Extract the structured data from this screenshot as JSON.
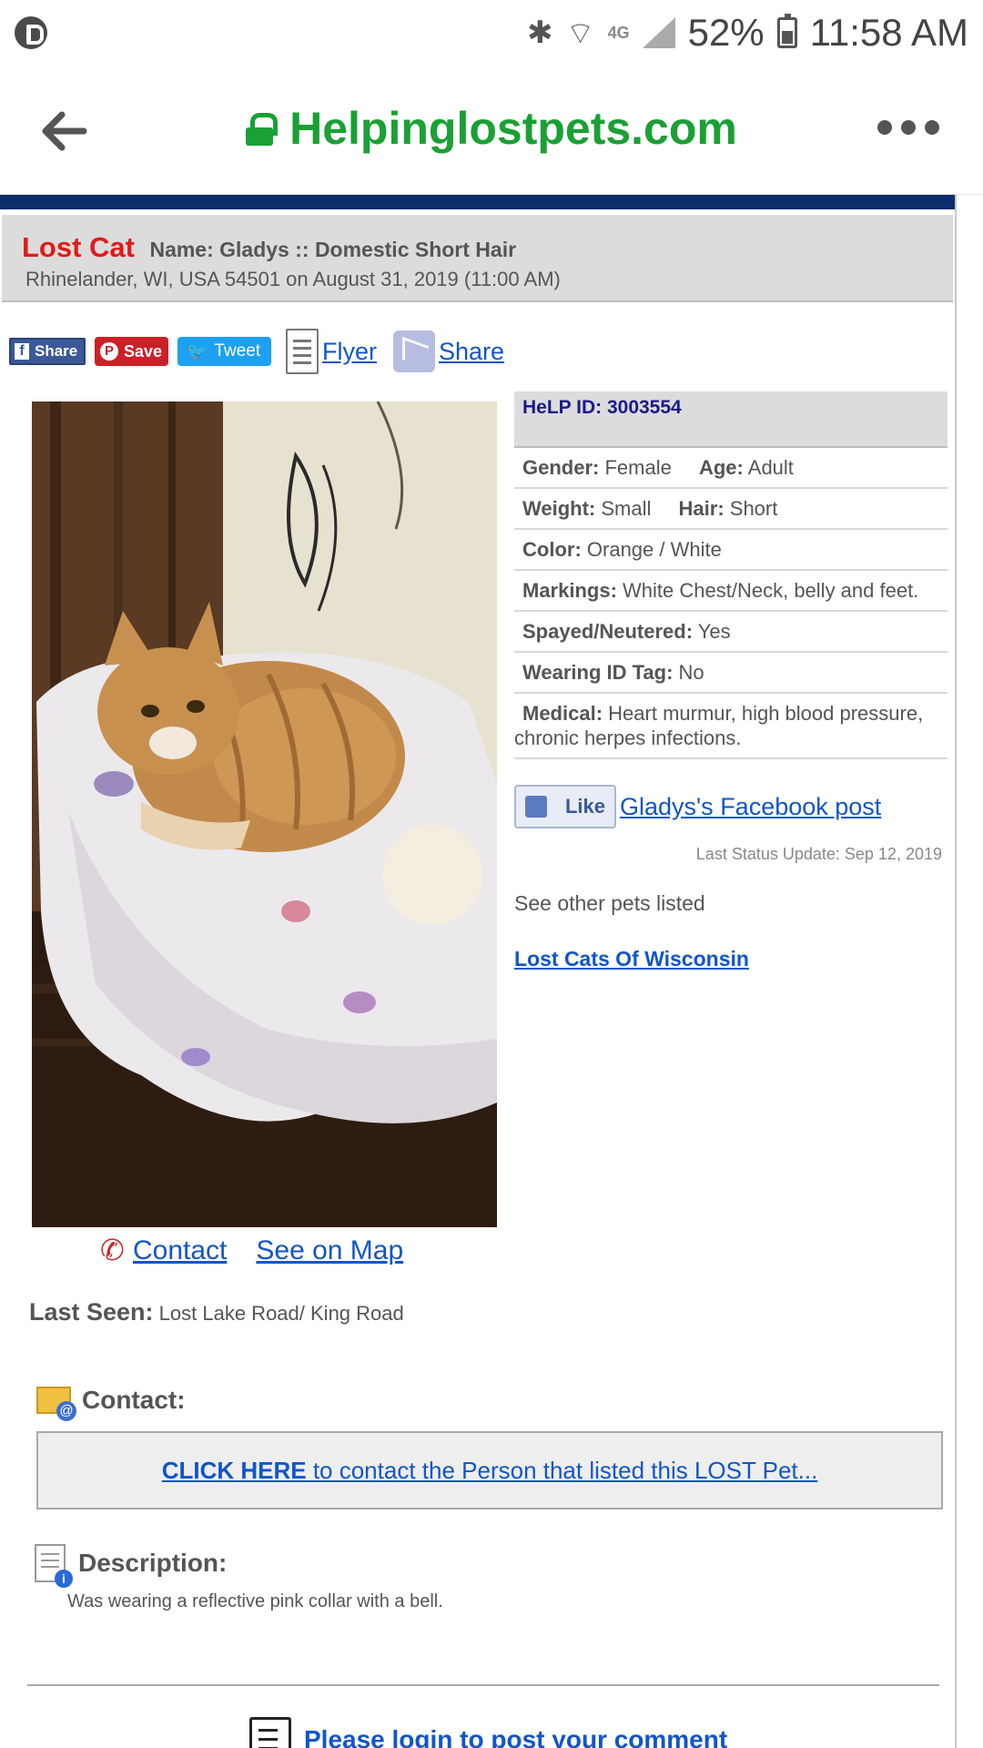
{
  "status_bar": {
    "battery": "52%",
    "time": "11:58 AM",
    "network": "4G"
  },
  "browser": {
    "url": "Helpinglostpets.com"
  },
  "header": {
    "status": "Lost Cat",
    "name_line": "Name: Gladys :: Domestic Short Hair",
    "location_line": "Rhinelander, WI, USA 54501 on August 31, 2019 (11:00 AM)"
  },
  "share_bar": {
    "facebook": "Share",
    "pinterest": "Save",
    "twitter": "Tweet",
    "flyer": "Flyer",
    "share": "Share"
  },
  "details": {
    "help_id": "HeLP ID: 3003554",
    "gender_label": "Gender:",
    "gender": "Female",
    "age_label": "Age:",
    "age": "Adult",
    "weight_label": "Weight:",
    "weight": "Small",
    "hair_label": "Hair:",
    "hair": "Short",
    "color_label": "Color:",
    "color": "Orange / White",
    "markings_label": "Markings:",
    "markings": "White Chest/Neck, belly and feet.",
    "spayed_label": "Spayed/Neutered:",
    "spayed": "Yes",
    "tag_label": "Wearing ID Tag:",
    "tag": "No",
    "medical_label": "Medical:",
    "medical": "Heart murmur, high blood pressure, chronic herpes infections."
  },
  "facebook_like": {
    "button": "Like",
    "post_link": "Gladys's Facebook post"
  },
  "last_status_update": "Last Status Update: Sep 12, 2019",
  "see_other": "See other pets listed",
  "lost_cats_link": "Lost Cats Of Wisconsin",
  "photo_links": {
    "contact": "Contact",
    "map": "See on Map"
  },
  "last_seen": {
    "label": "Last Seen:",
    "value": "Lost Lake Road/ King Road"
  },
  "contact": {
    "label": "Contact:",
    "click_here": "CLICK HERE",
    "rest": " to contact the Person that listed this LOST Pet..."
  },
  "description": {
    "label": "Description:",
    "text": "Was wearing a reflective pink collar with a bell."
  },
  "comments": {
    "login_link": "Please login to post your comment"
  },
  "colors": {
    "url_green": "#1aa035",
    "lost_red": "#e21a1a",
    "link_blue": "#1155cc",
    "help_id_navy": "#1a1a8c",
    "top_strip": "#0c2d6b"
  }
}
